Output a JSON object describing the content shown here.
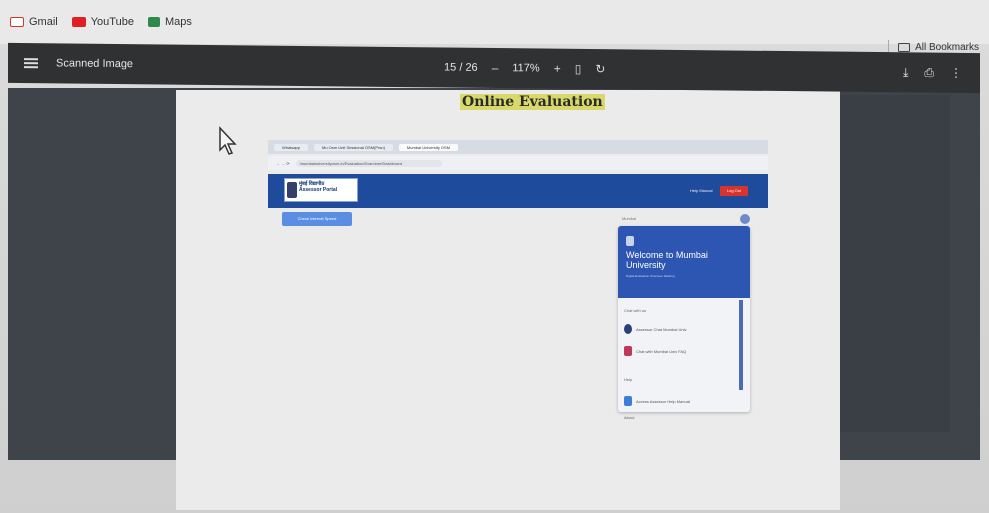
{
  "bookmarks": [
    {
      "label": "Gmail",
      "icon": "gmail-icon",
      "color": "#d0372b"
    },
    {
      "label": "YouTube",
      "icon": "youtube-icon",
      "color": "#e02020"
    },
    {
      "label": "Maps",
      "icon": "maps-icon",
      "color": "#2e8a4a"
    }
  ],
  "all_bookmarks": "All Bookmarks",
  "viewer": {
    "title": "Scanned Image",
    "page_current": "15",
    "page_separator": "/",
    "page_total": "26",
    "zoom_out_label": "–",
    "zoom": "117%",
    "zoom_in_label": "+",
    "fit_icon": "fit-page-icon",
    "rotate_icon": "rotate-icon",
    "download_label": "⤓",
    "print_label": "⎙",
    "more_label": "⋮"
  },
  "document": {
    "heading": "Online Evaluation"
  },
  "embedded": {
    "tabs": [
      "Whatsapp",
      "Mu Osm Unit Sessional OSM(Prsn)",
      "Mumbai University OSM"
    ],
    "address": "/mumbaiuniversityosm.in/Evaluation/Examiner/Dashboard",
    "logo_line1": "मुंबई विद्यापीठ",
    "logo_line2": "Assessor Portal",
    "help_label": "Help Manual",
    "login_label": "Log Out",
    "button_label": "Check Internet Speed",
    "panel_top": "Mumbai",
    "welcome": "Welcome to Mumbai University",
    "welcome_sub": "Digital Evaluation Onscreen Marking",
    "chat_label": "Chat with us",
    "row1": "Assessor Chat Mumbai Univ",
    "row2": "Chat with Mumbai Univ FAQ",
    "help_heading": "Help",
    "row3": "Access Assessor Help Manual",
    "footer": "About"
  },
  "colors": {
    "toolbar": "#2f3133",
    "viewer_bg": "#3f444b",
    "heading_highlight": "#d9d96b",
    "portal_header": "#1f4b9c",
    "login_button": "#d8332f"
  }
}
